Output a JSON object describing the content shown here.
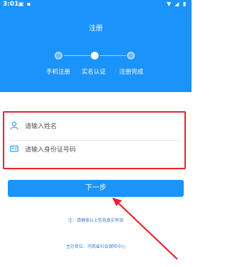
{
  "status_bar": {
    "time": "3:01"
  },
  "header": {
    "title": "注册"
  },
  "steps": [
    {
      "label": "手机注册",
      "state": "done"
    },
    {
      "label": "实名认证",
      "state": "current"
    },
    {
      "label": "注册完成",
      "state": "pending"
    }
  ],
  "form": {
    "name_placeholder": "请输入姓名",
    "id_placeholder": "请输入身份证号码"
  },
  "next_button": "下一步",
  "note": "注：请确保以上信息真实有效",
  "org": "主办单位：河南省社会保险中心",
  "colors": {
    "primary": "#1a93fb",
    "highlight": "#e8232b"
  }
}
